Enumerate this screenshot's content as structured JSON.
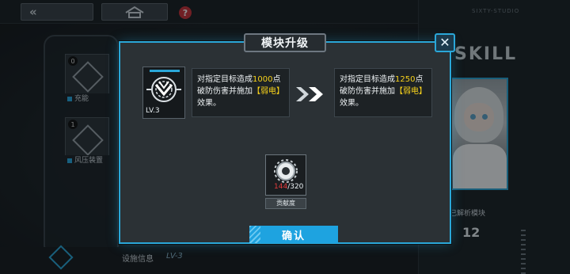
{
  "top_bar": {
    "back_glyph": "«",
    "help_glyph": "?"
  },
  "left_panel": {
    "items": [
      {
        "badge": "0",
        "label": "充能"
      },
      {
        "badge": "1",
        "label": "风压装置"
      }
    ]
  },
  "right_panel": {
    "studio": "SIXTY-STUDIO",
    "skill_word": "SKILL",
    "decode_label": "已解析模块",
    "decode_count": "12"
  },
  "bottom": {
    "facility_label": "设施信息",
    "facility_level": "LV-3"
  },
  "modal": {
    "title": "模块升级",
    "close_glyph": "✕",
    "module_level": "LV.3",
    "before": {
      "line1_pre": "对指定目标造成",
      "line1_num": "1000",
      "line1_post": "点",
      "line2_pre": "破防伤害并施加",
      "line2_tag": "【弱电】",
      "line3": "效果。"
    },
    "after": {
      "line1_pre": "对指定目标造成",
      "line1_num": "1250",
      "line1_post": "点",
      "line2_pre": "破防伤害并施加",
      "line2_tag": "【弱电】",
      "line3": "效果。"
    },
    "material": {
      "current": "144",
      "required": "/320",
      "label": "贡献度"
    },
    "confirm_label": "确认"
  },
  "colors": {
    "accent": "#2aa7d8",
    "highlight": "#f7d21b",
    "insufficient": "#e23b3b",
    "confirm_bg": "#1ea3e0"
  }
}
